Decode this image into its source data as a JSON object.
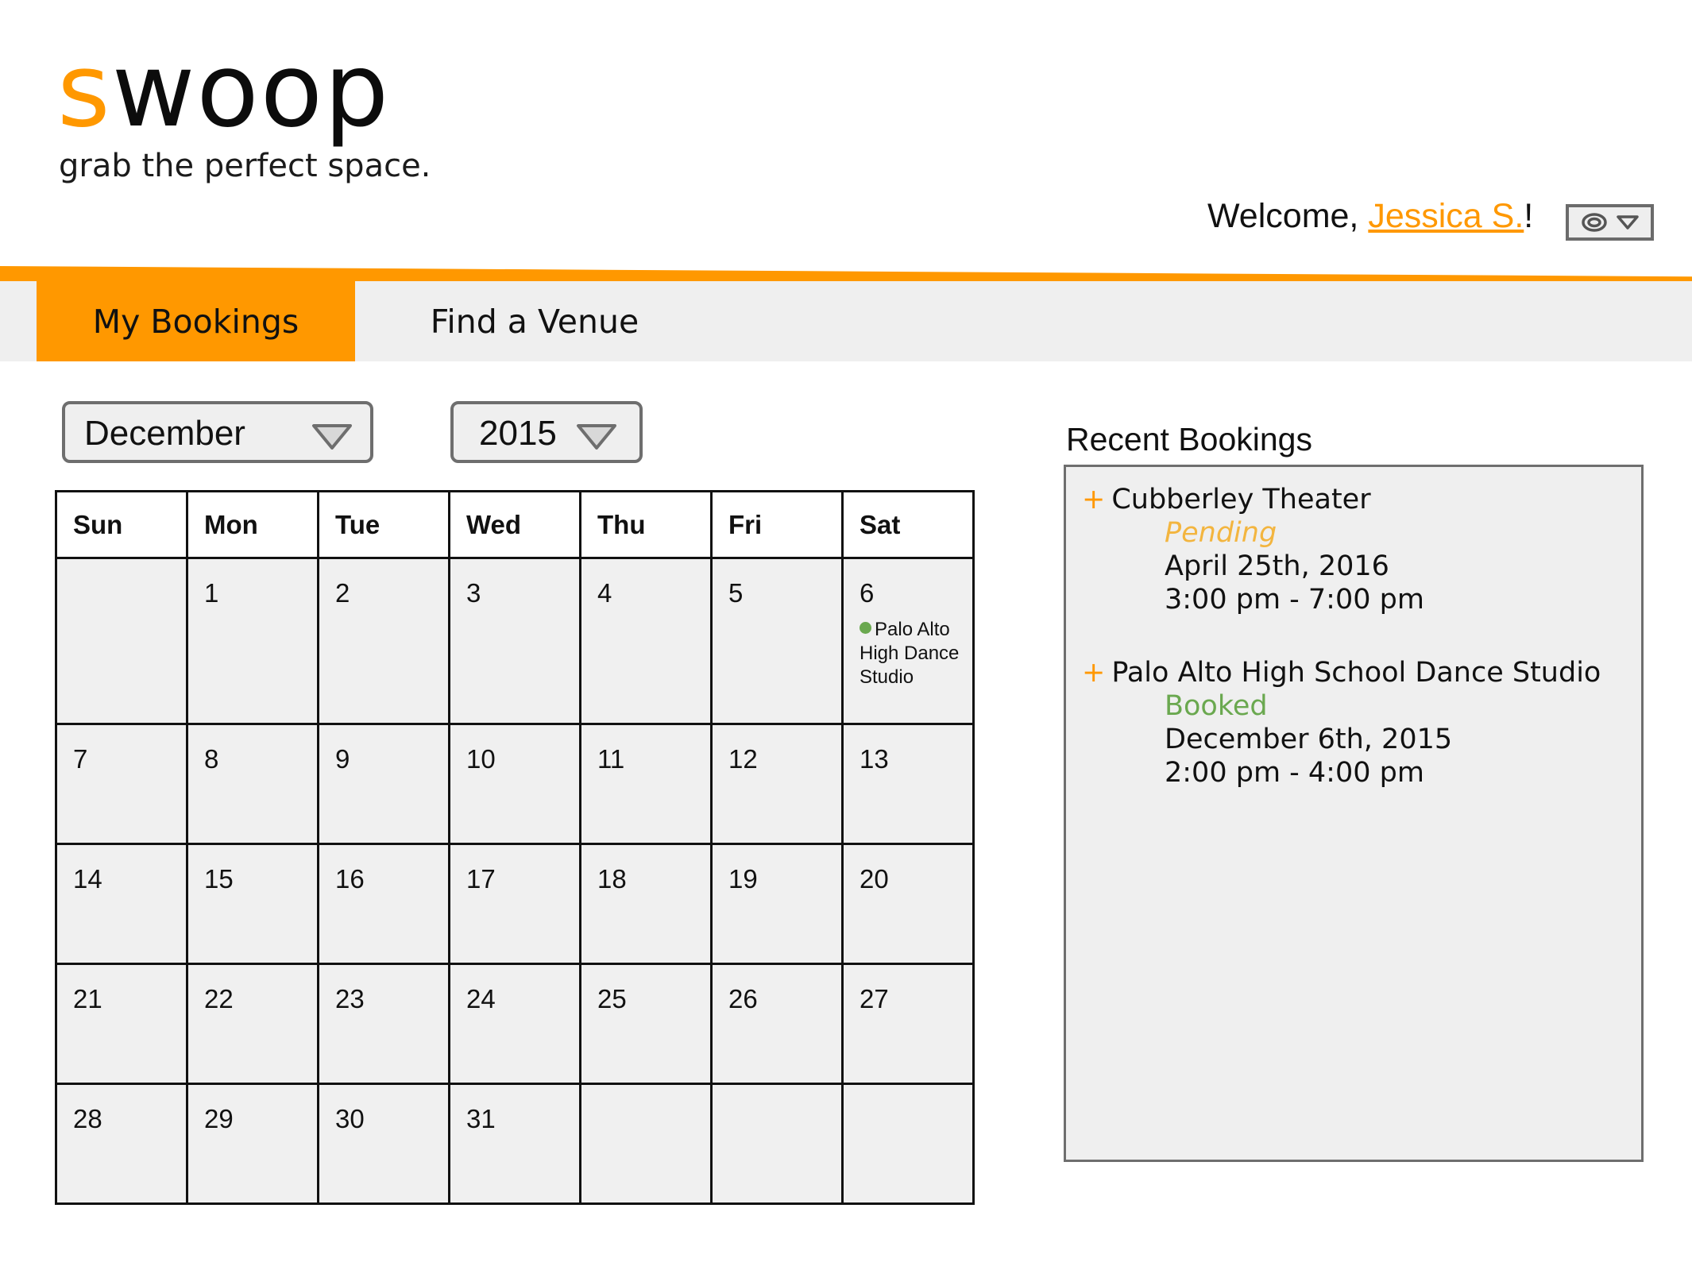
{
  "brand": {
    "logo_first_letter": "s",
    "logo_rest": "woop",
    "tagline": "grab the perfect space.",
    "accent_color": "#ff9800"
  },
  "header": {
    "welcome_prefix": "Welcome, ",
    "user_name": "Jessica S.",
    "welcome_suffix": "!",
    "account_menu_icon": "user-target-icon"
  },
  "nav": {
    "tabs": [
      {
        "label": "My Bookings",
        "active": true
      },
      {
        "label": "Find a Venue",
        "active": false
      }
    ]
  },
  "filters": {
    "month": "December",
    "year": "2015"
  },
  "calendar": {
    "weekdays": [
      "Sun",
      "Mon",
      "Tue",
      "Wed",
      "Thu",
      "Fri",
      "Sat"
    ],
    "weeks": [
      [
        "",
        "1",
        "2",
        "3",
        "4",
        "5",
        "6"
      ],
      [
        "7",
        "8",
        "9",
        "10",
        "11",
        "12",
        "13"
      ],
      [
        "14",
        "15",
        "16",
        "17",
        "18",
        "19",
        "20"
      ],
      [
        "21",
        "22",
        "23",
        "24",
        "25",
        "26",
        "27"
      ],
      [
        "28",
        "29",
        "30",
        "31",
        "",
        "",
        ""
      ]
    ],
    "event": {
      "date": "6",
      "title": "Palo Alto High Dance Studio",
      "color": "#6aa84f"
    }
  },
  "recent": {
    "title": "Recent Bookings",
    "bookings": [
      {
        "venue": "Cubberley Theater",
        "status": "Pending",
        "status_color": "#f3b53f",
        "date": "April 25th, 2016",
        "time": "3:00 pm - 7:00 pm"
      },
      {
        "venue": "Palo Alto High School Dance Studio",
        "status": "Booked",
        "status_color": "#6aa84f",
        "date": "December 6th, 2015",
        "time": "2:00 pm - 4:00 pm"
      }
    ]
  }
}
